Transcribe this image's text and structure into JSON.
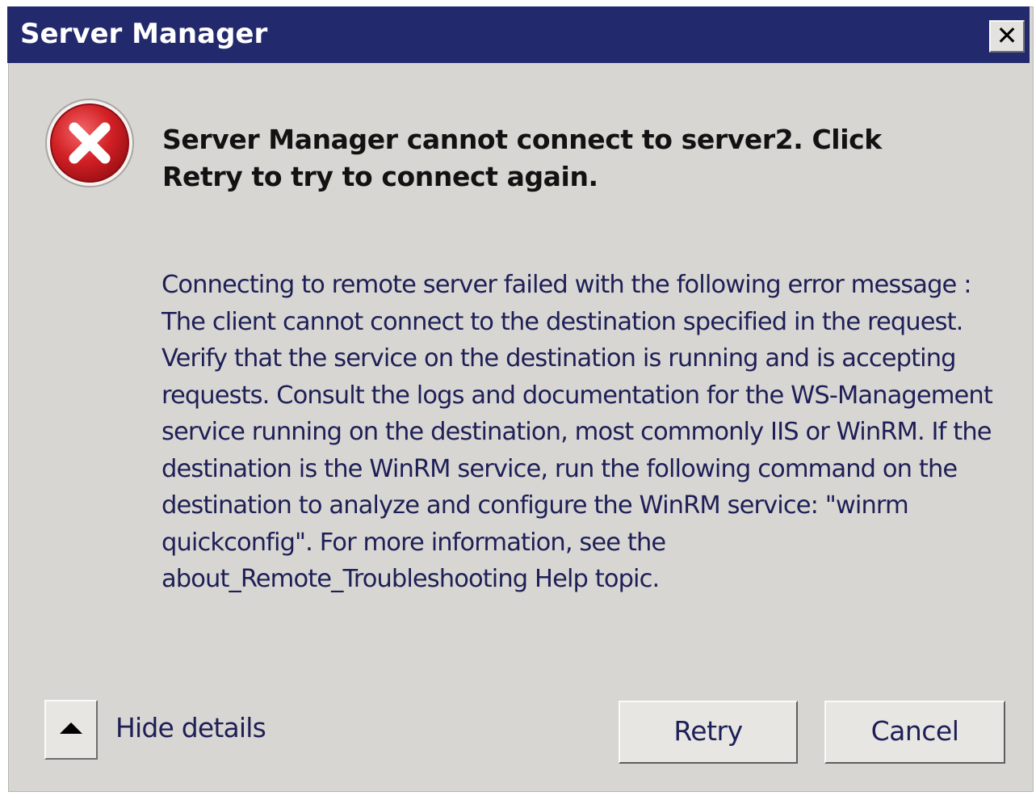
{
  "window": {
    "title": "Server Manager",
    "close_glyph": "✕"
  },
  "message": {
    "icon": "error-icon",
    "heading": "Server Manager cannot connect to server2. Click Retry to try to connect again.",
    "details": "Connecting to remote server failed with the following error message : The client cannot connect to the destination specified in the request. Verify that the service on the destination is running and is accepting requests. Consult the logs and documentation for the WS-Management service running on the destination, most commonly IIS or WinRM. If the destination is the WinRM service, run the following command on the destination to analyze and configure the WinRM service: \"winrm quickconfig\". For more information, see the about_Remote_Troubleshooting Help topic."
  },
  "footer": {
    "toggle_icon": "triangle-up-icon",
    "hide_details_label": "Hide details",
    "retry_label": "Retry",
    "cancel_label": "Cancel"
  },
  "colors": {
    "titlebar": "#222a6d",
    "dialog_bg": "#d8d6d2",
    "error_red": "#c8181c",
    "text_dark_blue": "#1d1f57"
  }
}
